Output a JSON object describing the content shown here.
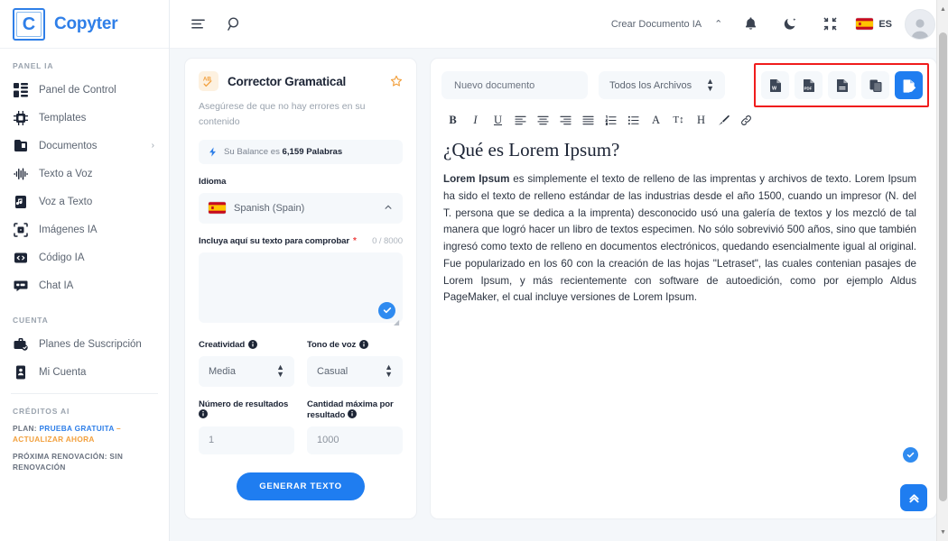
{
  "brand": {
    "mark": "C",
    "name": "Copyter"
  },
  "sidebar": {
    "section_panel": "PANEL IA",
    "items": [
      {
        "label": "Panel de Control",
        "icon": "dashboard-icon"
      },
      {
        "label": "Templates",
        "icon": "templates-icon"
      },
      {
        "label": "Documentos",
        "icon": "documents-icon",
        "chevron": "›"
      },
      {
        "label": "Texto a Voz",
        "icon": "waveform-icon"
      },
      {
        "label": "Voz a Texto",
        "icon": "audio-file-icon"
      },
      {
        "label": "Imágenes IA",
        "icon": "image-ai-icon"
      },
      {
        "label": "Código IA",
        "icon": "code-icon"
      },
      {
        "label": "Chat IA",
        "icon": "chat-icon"
      }
    ],
    "section_account": "CUENTA",
    "account_items": [
      {
        "label": "Planes de Suscripción",
        "icon": "briefcase-icon"
      },
      {
        "label": "Mi Cuenta",
        "icon": "id-card-icon"
      }
    ],
    "section_credits": "CRÉDITOS AI",
    "plan_prefix": "PLAN:",
    "plan_name": "PRUEBA GRATUITA",
    "plan_dash": "–",
    "plan_upgrade": "ACTUALIZAR AHORA",
    "renewal": "PRÓXIMA RENOVACIÓN: SIN RENOVACIÓN"
  },
  "topbar": {
    "menu_icon": "menu-icon",
    "search_icon": "search-icon",
    "create_doc": "Crear Documento IA",
    "caret": "⌃",
    "bell_icon": "bell-icon",
    "theme_icon": "moon-icon",
    "fullscreen_icon": "collapse-icon",
    "language": "ES"
  },
  "tool_panel": {
    "title": "Corrector Gramatical",
    "badge_icon": "spellcheck-icon",
    "star_icon": "star-icon",
    "subtitle": "Asegúrese de que no hay errores en su contenido",
    "balance_text_pre": "Su Balance es ",
    "balance_value": "6,159 Palabras",
    "language_label": "Idioma",
    "language_value": "Spanish (Spain)",
    "text_label": "Incluya aquí su texto para comprobar",
    "text_required": "*",
    "counter": "0 / 8000",
    "textarea_value": "",
    "creativity_label": "Creatividad",
    "creativity_value": "Media",
    "tone_label": "Tono de voz",
    "tone_value": "Casual",
    "results_label": "Número de resultados",
    "results_value": "1",
    "max_label": "Cantidad máxima por resultado",
    "max_value": "1000",
    "generate_button": "GENERAR TEXTO"
  },
  "editor": {
    "doc_name_value": "Nuevo documento",
    "file_filter_value": "Todos los Archivos",
    "export_buttons": [
      {
        "name": "export-word-button",
        "icon": "word-file-icon"
      },
      {
        "name": "export-pdf-button",
        "icon": "pdf-file-icon"
      },
      {
        "name": "export-text-button",
        "icon": "text-file-icon"
      },
      {
        "name": "copy-button",
        "icon": "copy-icon"
      },
      {
        "name": "save-document-button",
        "icon": "save-file-icon"
      }
    ],
    "format_buttons": [
      {
        "name": "bold-button",
        "glyph": "B"
      },
      {
        "name": "italic-button",
        "glyph": "I"
      },
      {
        "name": "underline-button",
        "glyph": "U"
      },
      {
        "name": "align-left-button",
        "glyph": "align-left-icon"
      },
      {
        "name": "align-center-button",
        "glyph": "align-center-icon"
      },
      {
        "name": "align-right-button",
        "glyph": "align-right-icon"
      },
      {
        "name": "align-justify-button",
        "glyph": "align-justify-icon"
      },
      {
        "name": "ordered-list-button",
        "glyph": "ordered-list-icon"
      },
      {
        "name": "unordered-list-button",
        "glyph": "unordered-list-icon"
      },
      {
        "name": "font-color-button",
        "glyph": "A"
      },
      {
        "name": "font-size-button",
        "glyph": "T↕"
      },
      {
        "name": "heading-button",
        "glyph": "H"
      },
      {
        "name": "highlight-button",
        "glyph": "brush-icon"
      },
      {
        "name": "link-button",
        "glyph": "link-icon"
      }
    ],
    "heading": "¿Qué es Lorem Ipsum?",
    "paragraph_bold": "Lorem Ipsum",
    "paragraph": " es simplemente el texto de relleno de las imprentas y archivos de texto. Lorem Ipsum ha sido el texto de relleno estándar de las industrias desde el año 1500, cuando un impresor (N. del T. persona que se dedica a la imprenta) desconocido usó una galería de textos y los mezcló de tal manera que logró hacer un libro de textos especimen. No sólo sobrevivió 500 años, sino que también ingresó como texto de relleno en documentos electrónicos, quedando esencialmente igual al original. Fue popularizado en los 60 con la creación de las hojas \"Letraset\", las cuales contenian pasajes de Lorem Ipsum, y más recientemente con software de autoedición, como por ejemplo Aldus PageMaker, el cual incluye versiones de Lorem Ipsum.",
    "check_icon": "check-icon",
    "scroll_top_icon": "double-chevron-up-icon"
  },
  "colors": {
    "brand_blue": "#2f7fe8",
    "primary_blue": "#1f7df0",
    "accent_orange": "#f2a03d",
    "annotation_red": "#f01c1c"
  }
}
